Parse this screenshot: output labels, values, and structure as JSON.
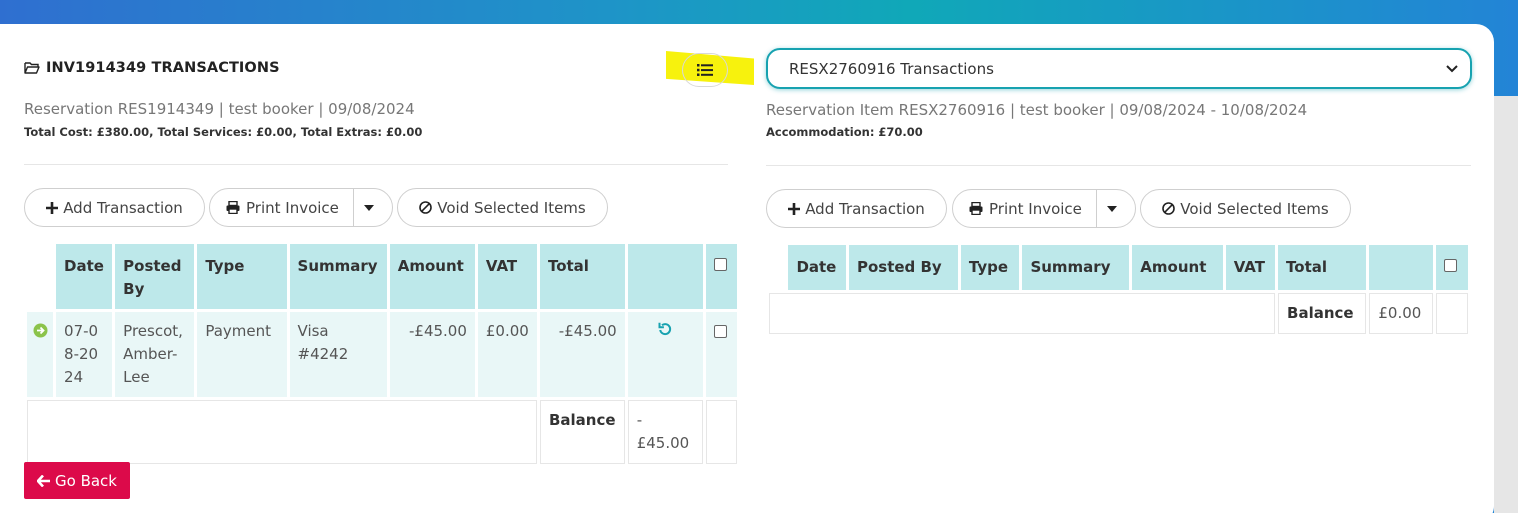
{
  "left": {
    "title": "INV1914349 TRANSACTIONS",
    "subtitle": "Reservation RES1914349 | test booker | 09/08/2024",
    "totals": "Total Cost: £380.00, Total Services: £0.00, Total Extras: £0.00",
    "buttons": {
      "add": "Add Transaction",
      "print": "Print Invoice",
      "void": "Void Selected Items"
    },
    "headers": [
      "Date",
      "Posted By",
      "Type",
      "Summary",
      "Amount",
      "VAT",
      "Total"
    ],
    "rows": [
      {
        "date": "07-08-2024",
        "posted_by": "Prescot, Amber-Lee",
        "type": "Payment",
        "summary": "Visa #4242",
        "amount": "-£45.00",
        "vat": "£0.00",
        "total": "-£45.00"
      }
    ],
    "balance_label": "Balance",
    "balance_value": "-£45.00"
  },
  "right": {
    "select_value": "RESX2760916 Transactions",
    "subtitle": "Reservation Item RESX2760916 | test booker | 09/08/2024 - 10/08/2024",
    "totals": "Accommodation: £70.00",
    "buttons": {
      "add": "Add Transaction",
      "print": "Print Invoice",
      "void": "Void Selected Items"
    },
    "headers": [
      "Date",
      "Posted By",
      "Type",
      "Summary",
      "Amount",
      "VAT",
      "Total"
    ],
    "balance_label": "Balance",
    "balance_value": "£0.00"
  },
  "go_back": "Go Back",
  "colors": {
    "accent": "#17a2b0",
    "header_bg": "#bde8ea",
    "row_bg": "#e9f7f7",
    "danger": "#dc0a4a",
    "highlight": "#f7f20d",
    "arrow": "#8bc34a"
  },
  "icons": [
    "folder-open-icon",
    "list-icon",
    "chevron-down-icon",
    "plus-icon",
    "print-icon",
    "caret-down-icon",
    "ban-icon",
    "arrow-circle-right-icon",
    "undo-icon",
    "arrow-left-icon"
  ]
}
